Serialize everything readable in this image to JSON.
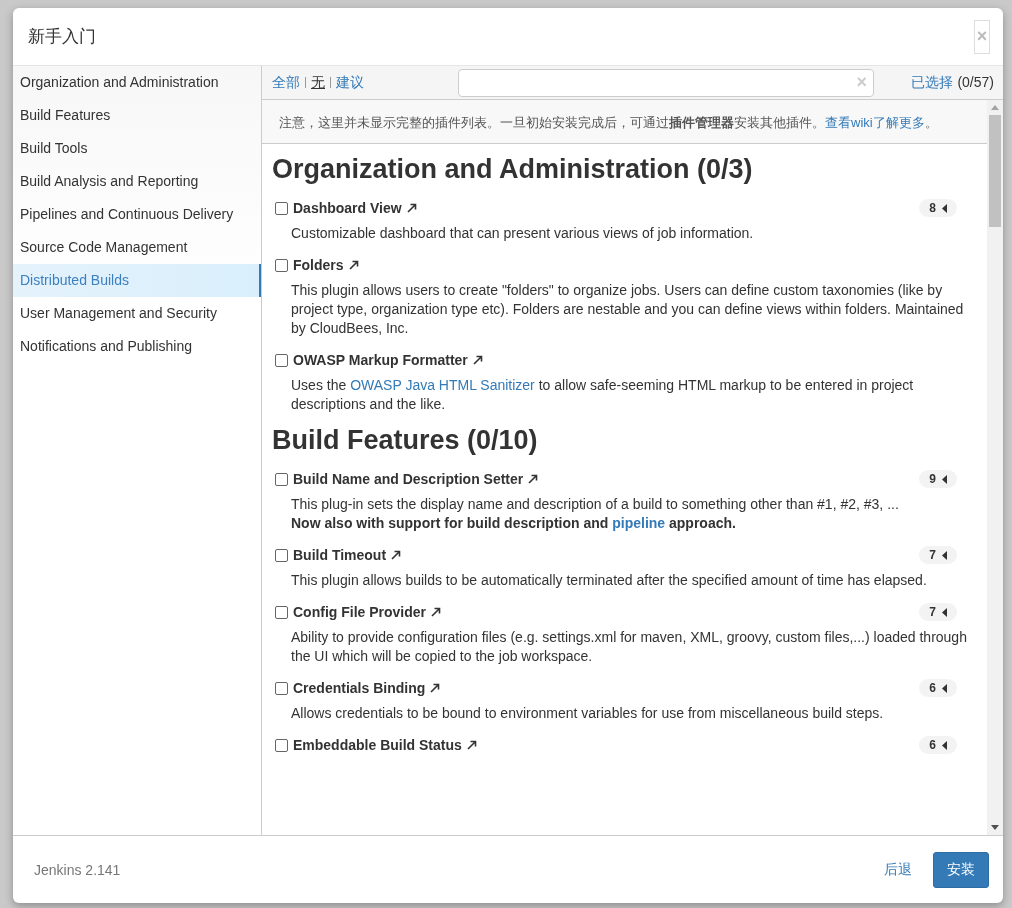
{
  "dialog": {
    "title": "新手入门",
    "close": "×"
  },
  "sidebar": {
    "items": [
      {
        "label": "Organization and Administration",
        "selected": false
      },
      {
        "label": "Build Features",
        "selected": false
      },
      {
        "label": "Build Tools",
        "selected": false
      },
      {
        "label": "Build Analysis and Reporting",
        "selected": false
      },
      {
        "label": "Pipelines and Continuous Delivery",
        "selected": false
      },
      {
        "label": "Source Code Management",
        "selected": false
      },
      {
        "label": "Distributed Builds",
        "selected": true
      },
      {
        "label": "User Management and Security",
        "selected": false
      },
      {
        "label": "Notifications and Publishing",
        "selected": false
      }
    ]
  },
  "toolbar": {
    "filters": [
      {
        "label": "全部",
        "selected": false
      },
      {
        "label": "无",
        "selected": true
      },
      {
        "label": "建议",
        "selected": false
      }
    ],
    "search": {
      "clear": "×"
    },
    "selected_link": "已选择",
    "selected_count": "(0/57)"
  },
  "notice": {
    "text": "注意，这里并未显示完整的插件列表。一旦初始安装完成后，可通过**插件管理器**安装其他插件。",
    "link": "查看wiki了解更多",
    "end": "。"
  },
  "sections": [
    {
      "title": "Organization and Administration (0/3)",
      "plugins": [
        {
          "name": "Dashboard View",
          "checked": false,
          "count": "8",
          "lines": [
            {
              "kind": "plain",
              "parts": [
                {
                  "kind": "text",
                  "text": "Customizable dashboard that can present various views of job information."
                }
              ]
            }
          ]
        },
        {
          "name": "Folders",
          "checked": false,
          "lines": [
            {
              "kind": "plain",
              "parts": [
                {
                  "kind": "text",
                  "text": "This plugin allows users to create \"folders\" to organize jobs. Users can define custom taxonomies (like by project type, organization type etc). Folders are nestable and you can define views within folders. Maintained by CloudBees, Inc."
                }
              ]
            }
          ]
        },
        {
          "name": "OWASP Markup Formatter",
          "checked": false,
          "lines": [
            {
              "kind": "plain",
              "parts": [
                {
                  "kind": "text",
                  "text": "Uses the "
                },
                {
                  "kind": "link",
                  "text": "OWASP Java HTML Sanitizer"
                },
                {
                  "kind": "text",
                  "text": " to allow safe-seeming HTML markup to be entered in project descriptions and the like."
                }
              ]
            }
          ]
        }
      ]
    },
    {
      "title": "Build Features (0/10)",
      "plugins": [
        {
          "name": "Build Name and Description Setter",
          "checked": false,
          "count": "9",
          "lines": [
            {
              "kind": "plain",
              "parts": [
                {
                  "kind": "text",
                  "text": "This plug-in sets the display name and description of a build to something other than #1, #2, #3, ..."
                }
              ]
            },
            {
              "kind": "bold",
              "parts": [
                {
                  "kind": "text",
                  "text": "Now also with support for build description and "
                },
                {
                  "kind": "link",
                  "text": "pipeline"
                },
                {
                  "kind": "text",
                  "text": " approach."
                }
              ]
            }
          ]
        },
        {
          "name": "Build Timeout",
          "checked": false,
          "count": "7",
          "lines": [
            {
              "kind": "plain",
              "parts": [
                {
                  "kind": "text",
                  "text": "This plugin allows builds to be automatically terminated after the specified amount of time has elapsed."
                }
              ]
            }
          ]
        },
        {
          "name": "Config File Provider",
          "checked": false,
          "count": "7",
          "lines": [
            {
              "kind": "plain",
              "parts": [
                {
                  "kind": "text",
                  "text": "Ability to provide configuration files (e.g. settings.xml for maven, XML, groovy, custom files,...) loaded through the UI which will be copied to the job workspace."
                }
              ]
            }
          ]
        },
        {
          "name": "Credentials Binding",
          "checked": false,
          "count": "6",
          "lines": [
            {
              "kind": "plain",
              "parts": [
                {
                  "kind": "text",
                  "text": "Allows credentials to be bound to environment variables for use from miscellaneous build steps."
                }
              ]
            }
          ]
        },
        {
          "name": "Embeddable Build Status",
          "checked": false,
          "count": "6"
        }
      ]
    }
  ],
  "footer": {
    "version": "Jenkins 2.141",
    "back": "后退",
    "install": "安装"
  }
}
